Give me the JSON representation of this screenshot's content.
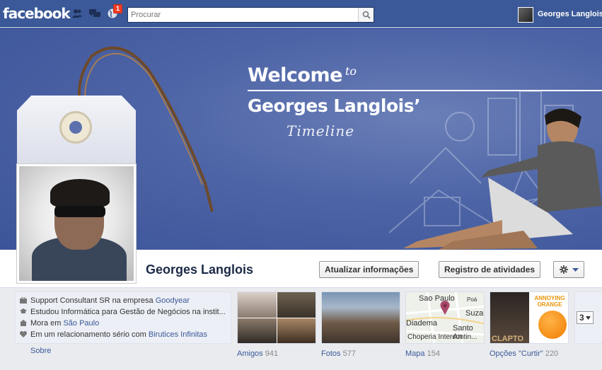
{
  "topbar": {
    "logo": "facebook",
    "notification_count": "1",
    "search_placeholder": "Procurar",
    "user_name": "Georges Langlois"
  },
  "cover": {
    "welcome": "Welcome",
    "to": "to",
    "name": "Georges Langlois’",
    "timeline": "Timeline"
  },
  "profile": {
    "name": "Georges Langlois",
    "update_button": "Atualizar informações",
    "activity_button": "Registro de atividades"
  },
  "info": {
    "work_prefix": "Support Consultant SR na empresa ",
    "work_link": "Goodyear",
    "study": "Estudou Informática para Gestão de Negócios na instit...",
    "lives_prefix": "Mora em ",
    "lives_link": "São Paulo",
    "relationship_prefix": "Em um relacionamento sério com ",
    "relationship_link": "Birutices Infinitas",
    "about": "Sobre"
  },
  "apps": [
    {
      "label": "Amigos",
      "count": "941"
    },
    {
      "label": "Fotos",
      "count": "577"
    },
    {
      "label": "Mapa",
      "count": "154"
    },
    {
      "label": "Opções \"Curtir\"",
      "count": "220"
    }
  ],
  "map": {
    "city1": "Sao Paulo",
    "city2": "Suzan",
    "city3": "Diadema",
    "city4": "Santo An",
    "city5": "Poá",
    "place": "Choperia Intercontin..."
  },
  "likes": {
    "tile1": "CLAPTO",
    "tile2": "ANNOYING ORANGE"
  },
  "more_count": "3",
  "colors": {
    "brand": "#3b5998",
    "cover": "#4d64a6"
  }
}
